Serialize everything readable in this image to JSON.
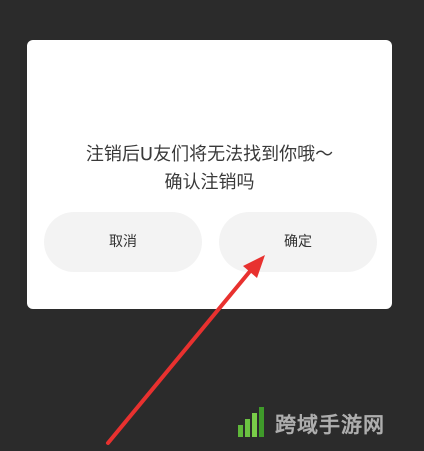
{
  "dialog": {
    "message_line1": "注销后U友们将无法找到你哦～",
    "message_line2": "确认注销吗",
    "cancel_label": "取消",
    "confirm_label": "确定"
  },
  "watermark": {
    "text": "跨域手游网"
  },
  "colors": {
    "backdrop": "#2b2b2b",
    "dialog_bg": "#ffffff",
    "button_bg": "#f3f3f3",
    "annotation_arrow": "#e8312f"
  },
  "icons": {
    "watermark_logo": "green-bars-logo-icon",
    "annotation": "red-arrow-icon"
  }
}
